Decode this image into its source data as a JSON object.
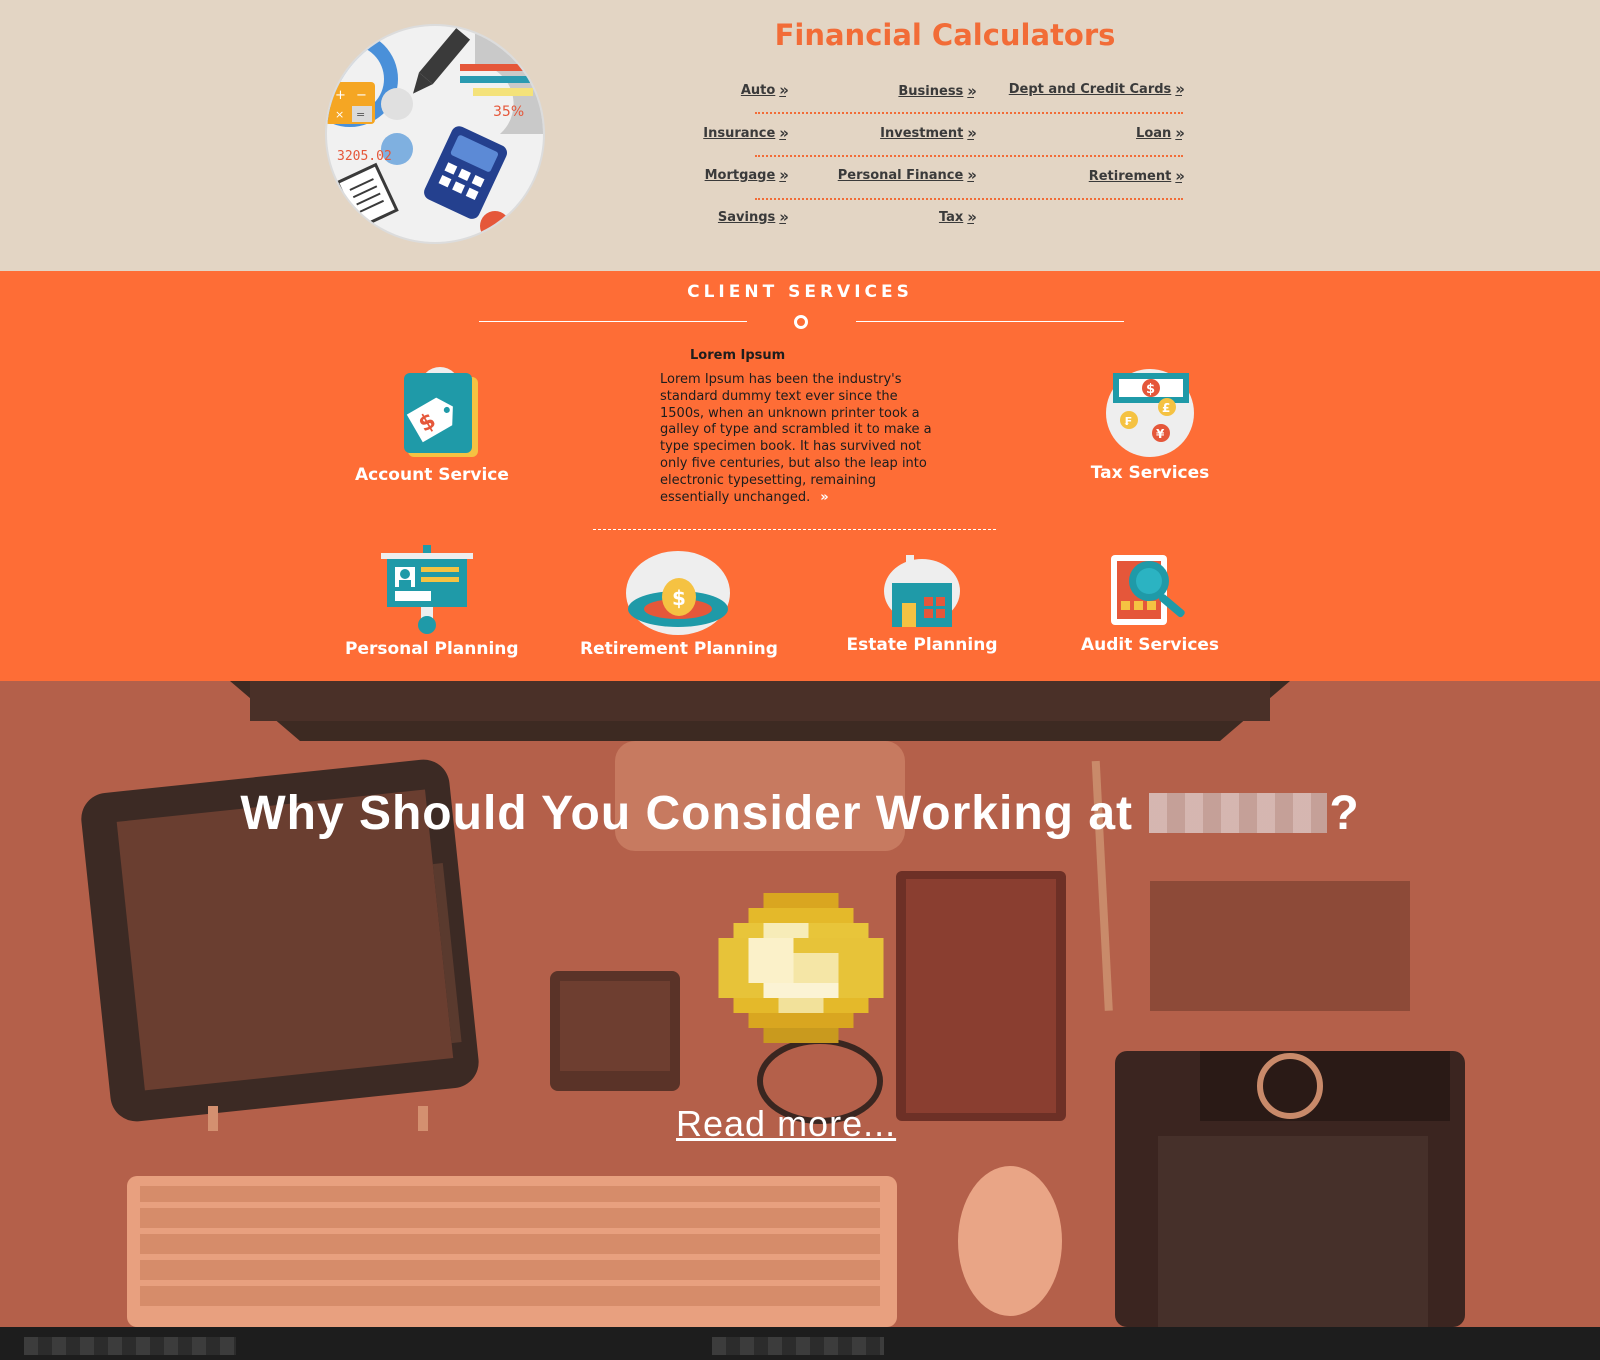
{
  "calculators": {
    "title": "Financial Calculators",
    "chevron": "»",
    "links": [
      {
        "label": "Auto"
      },
      {
        "label": "Business"
      },
      {
        "label": "Dept and Credit Cards"
      },
      {
        "label": "Insurance"
      },
      {
        "label": "Investment"
      },
      {
        "label": "Loan"
      },
      {
        "label": "Mortgage"
      },
      {
        "label": "Personal Finance"
      },
      {
        "label": "Retirement"
      },
      {
        "label": "Savings"
      },
      {
        "label": "Tax"
      }
    ],
    "illustration": {
      "percent": "35%",
      "amount": "3205.02"
    }
  },
  "services": {
    "heading": "CLIENT SERVICES",
    "lorem_title": "Lorem Ipsum",
    "lorem_body": "Lorem Ipsum has been the industry's standard dummy text ever since the 1500s, when an unknown printer took a galley of type and scrambled it to make a type specimen book. It has survived not only five centuries, but also the leap into electronic typesetting, remaining essentially unchanged.",
    "lorem_more": "»",
    "items": [
      {
        "label": "Account Service",
        "icon": "price-tag-icon"
      },
      {
        "label": "Tax Services",
        "icon": "currency-icon"
      },
      {
        "label": "Personal Planning",
        "icon": "presentation-board-icon"
      },
      {
        "label": "Retirement Planning",
        "icon": "coin-savings-icon"
      },
      {
        "label": "Estate Planning",
        "icon": "house-icon"
      },
      {
        "label": "Audit Services",
        "icon": "magnifier-calculator-icon"
      }
    ]
  },
  "hero": {
    "title_prefix": "Why Should You Consider Working at",
    "title_suffix": "?",
    "read_more": "Read more..."
  },
  "colors": {
    "accent": "#fe6d36",
    "calc_bg": "#e3d5c4",
    "title_orange": "#f26c37",
    "hero_overlay": "#b4604a",
    "footer": "#1d1d1d"
  }
}
